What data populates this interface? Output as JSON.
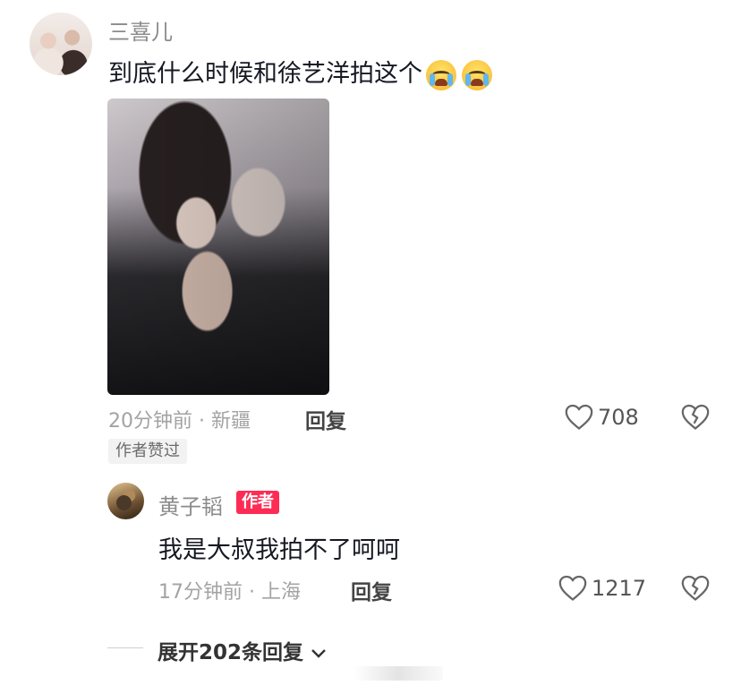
{
  "comment": {
    "username": "三喜儿",
    "text": "到底什么时候和徐艺洋拍这个",
    "emojis": [
      "crying-face",
      "crying-face"
    ],
    "time": "20分钟前",
    "location": "新疆",
    "separator": "·",
    "reply_label": "回复",
    "like_count": "708",
    "author_liked": "作者赞过"
  },
  "reply": {
    "username": "黄子韬",
    "badge": "作者",
    "text": "我是大叔我拍不了呵呵",
    "time": "17分钟前",
    "location": "上海",
    "separator": "·",
    "reply_label": "回复",
    "like_count": "1217"
  },
  "expand": {
    "label": "展开202条回复"
  },
  "colors": {
    "badge": "#fe2c55",
    "meta": "#a3a3a3",
    "text": "#161823"
  }
}
